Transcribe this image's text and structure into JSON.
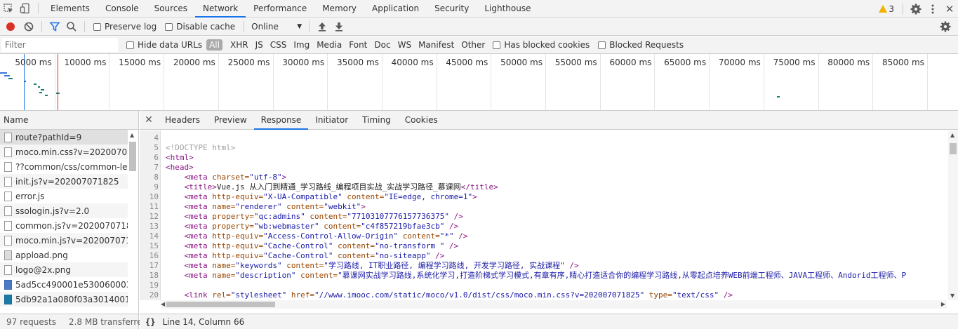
{
  "devtools": {
    "panels": [
      "Elements",
      "Console",
      "Sources",
      "Network",
      "Performance",
      "Memory",
      "Application",
      "Security",
      "Lighthouse"
    ],
    "active_panel": "Network",
    "warning_count": "3"
  },
  "toolbar": {
    "preserve_log": "Preserve log",
    "disable_cache": "Disable cache",
    "throttle": "Online"
  },
  "filterbar": {
    "placeholder": "Filter",
    "hide_data_urls": "Hide data URLs",
    "types": [
      "All",
      "XHR",
      "JS",
      "CSS",
      "Img",
      "Media",
      "Font",
      "Doc",
      "WS",
      "Manifest",
      "Other"
    ],
    "has_blocked_cookies": "Has blocked cookies",
    "blocked_requests": "Blocked Requests"
  },
  "overview": {
    "ticks": [
      "5000 ms",
      "10000 ms",
      "15000 ms",
      "20000 ms",
      "25000 ms",
      "30000 ms",
      "35000 ms",
      "40000 ms",
      "45000 ms",
      "50000 ms",
      "55000 ms",
      "60000 ms",
      "65000 ms",
      "70000 ms",
      "75000 ms",
      "80000 ms",
      "85000 ms",
      "90"
    ]
  },
  "requests": {
    "header": "Name",
    "items": [
      {
        "name": "route?pathId=9",
        "icon": "doc"
      },
      {
        "name": "moco.min.css?v=2020070718",
        "icon": "doc"
      },
      {
        "name": "??common/css/common-less.",
        "icon": "doc"
      },
      {
        "name": "init.js?v=202007071825",
        "icon": "doc"
      },
      {
        "name": "error.js",
        "icon": "doc"
      },
      {
        "name": "ssologin.js?v=2.0",
        "icon": "doc"
      },
      {
        "name": "common.js?v=202007071825",
        "icon": "doc"
      },
      {
        "name": "moco.min.js?v=202007071825",
        "icon": "doc"
      },
      {
        "name": "appload.png",
        "icon": "img"
      },
      {
        "name": "logo@2x.png",
        "icon": "doc"
      },
      {
        "name": "5ad5cc490001e53006000338.j",
        "icon": "blue"
      },
      {
        "name": "5db92a1a080f03a301400140.j",
        "icon": "teal"
      }
    ]
  },
  "details": {
    "tabs": [
      "Headers",
      "Preview",
      "Response",
      "Initiator",
      "Timing",
      "Cookies"
    ],
    "active_tab": "Response",
    "lines": [
      {
        "n": "4",
        "parts": []
      },
      {
        "n": "5",
        "parts": [
          {
            "c": "c-gray",
            "t": "<!DOCTYPE html>"
          }
        ]
      },
      {
        "n": "6",
        "parts": [
          {
            "c": "c-tag",
            "t": "<html>"
          }
        ]
      },
      {
        "n": "7",
        "parts": [
          {
            "c": "c-tag",
            "t": "<head>"
          }
        ]
      },
      {
        "n": "8",
        "parts": [
          {
            "c": "c-text",
            "t": "    "
          },
          {
            "c": "c-tag",
            "t": "<meta "
          },
          {
            "c": "c-attr",
            "t": "charset="
          },
          {
            "c": "c-val",
            "t": "\"utf-8\""
          },
          {
            "c": "c-tag",
            "t": ">"
          }
        ]
      },
      {
        "n": "9",
        "parts": [
          {
            "c": "c-text",
            "t": "    "
          },
          {
            "c": "c-tag",
            "t": "<title>"
          },
          {
            "c": "c-text",
            "t": "Vue.js 从入门到精通_学习路线_编程项目实战_实战学习路径_慕课网"
          },
          {
            "c": "c-tag",
            "t": "</title>"
          }
        ]
      },
      {
        "n": "10",
        "parts": [
          {
            "c": "c-text",
            "t": "    "
          },
          {
            "c": "c-tag",
            "t": "<meta "
          },
          {
            "c": "c-attr",
            "t": "http-equiv="
          },
          {
            "c": "c-val",
            "t": "\"X-UA-Compatible\""
          },
          {
            "c": "c-attr",
            "t": " content="
          },
          {
            "c": "c-val",
            "t": "\"IE=edge, chrome=1\""
          },
          {
            "c": "c-tag",
            "t": ">"
          }
        ]
      },
      {
        "n": "11",
        "parts": [
          {
            "c": "c-text",
            "t": "    "
          },
          {
            "c": "c-tag",
            "t": "<meta "
          },
          {
            "c": "c-attr",
            "t": "name="
          },
          {
            "c": "c-val",
            "t": "\"renderer\""
          },
          {
            "c": "c-attr",
            "t": " content="
          },
          {
            "c": "c-val",
            "t": "\"webkit\""
          },
          {
            "c": "c-tag",
            "t": ">"
          }
        ]
      },
      {
        "n": "12",
        "parts": [
          {
            "c": "c-text",
            "t": "    "
          },
          {
            "c": "c-tag",
            "t": "<meta "
          },
          {
            "c": "c-attr",
            "t": "property="
          },
          {
            "c": "c-val",
            "t": "\"qc:admins\""
          },
          {
            "c": "c-attr",
            "t": " content="
          },
          {
            "c": "c-val",
            "t": "\"77103107776157736375\""
          },
          {
            "c": "c-tag",
            "t": " />"
          }
        ]
      },
      {
        "n": "13",
        "parts": [
          {
            "c": "c-text",
            "t": "    "
          },
          {
            "c": "c-tag",
            "t": "<meta "
          },
          {
            "c": "c-attr",
            "t": "property="
          },
          {
            "c": "c-val",
            "t": "\"wb:webmaster\""
          },
          {
            "c": "c-attr",
            "t": " content="
          },
          {
            "c": "c-val",
            "t": "\"c4f857219bfae3cb\""
          },
          {
            "c": "c-tag",
            "t": " />"
          }
        ]
      },
      {
        "n": "14",
        "parts": [
          {
            "c": "c-text",
            "t": "    "
          },
          {
            "c": "c-tag",
            "t": "<meta "
          },
          {
            "c": "c-attr",
            "t": "http-equiv="
          },
          {
            "c": "c-val",
            "t": "\"Access-Control-Allow-Origin\""
          },
          {
            "c": "c-attr",
            "t": " content="
          },
          {
            "c": "c-val",
            "t": "\"*\""
          },
          {
            "c": "c-tag",
            "t": " />"
          }
        ]
      },
      {
        "n": "15",
        "parts": [
          {
            "c": "c-text",
            "t": "    "
          },
          {
            "c": "c-tag",
            "t": "<meta "
          },
          {
            "c": "c-attr",
            "t": "http-equiv="
          },
          {
            "c": "c-val",
            "t": "\"Cache-Control\""
          },
          {
            "c": "c-attr",
            "t": " content="
          },
          {
            "c": "c-val",
            "t": "\"no-transform \""
          },
          {
            "c": "c-tag",
            "t": " />"
          }
        ]
      },
      {
        "n": "16",
        "parts": [
          {
            "c": "c-text",
            "t": "    "
          },
          {
            "c": "c-tag",
            "t": "<meta "
          },
          {
            "c": "c-attr",
            "t": "http-equiv="
          },
          {
            "c": "c-val",
            "t": "\"Cache-Control\""
          },
          {
            "c": "c-attr",
            "t": " content="
          },
          {
            "c": "c-val",
            "t": "\"no-siteapp\""
          },
          {
            "c": "c-tag",
            "t": " />"
          }
        ]
      },
      {
        "n": "17",
        "parts": [
          {
            "c": "c-text",
            "t": "    "
          },
          {
            "c": "c-tag",
            "t": "<meta "
          },
          {
            "c": "c-attr",
            "t": "name="
          },
          {
            "c": "c-val",
            "t": "\"keywords\""
          },
          {
            "c": "c-attr",
            "t": " content="
          },
          {
            "c": "c-val",
            "t": "\"学习路线, IT职业路径, 编程学习路线, 开发学习路径, 实战课程\""
          },
          {
            "c": "c-tag",
            "t": " />"
          }
        ]
      },
      {
        "n": "18",
        "parts": [
          {
            "c": "c-text",
            "t": "    "
          },
          {
            "c": "c-tag",
            "t": "<meta "
          },
          {
            "c": "c-attr",
            "t": "name="
          },
          {
            "c": "c-val",
            "t": "\"description\""
          },
          {
            "c": "c-attr",
            "t": " content="
          },
          {
            "c": "c-val",
            "t": "\"慕课网实战学习路线,系统化学习,打造阶梯式学习模式,有章有序,精心打造适合你的编程学习路线,从零起点培养WEB前端工程师、JAVA工程师、Andorid工程师、P"
          }
        ]
      },
      {
        "n": "19",
        "parts": []
      },
      {
        "n": "20",
        "parts": [
          {
            "c": "c-text",
            "t": "    "
          },
          {
            "c": "c-tag",
            "t": "<link "
          },
          {
            "c": "c-attr",
            "t": "rel="
          },
          {
            "c": "c-val",
            "t": "\"stylesheet\""
          },
          {
            "c": "c-attr",
            "t": " href="
          },
          {
            "c": "c-val",
            "t": "\"//www.imooc.com/static/moco/v1.0/dist/css/moco.min.css?v=202007071825\""
          },
          {
            "c": "c-attr",
            "t": " type="
          },
          {
            "c": "c-val",
            "t": "\"text/css\""
          },
          {
            "c": "c-tag",
            "t": " />"
          }
        ]
      },
      {
        "n": "21",
        "parts": []
      }
    ]
  },
  "status": {
    "requests": "97 requests",
    "transferred": "2.8 MB transferred",
    "cursor": "Line 14, Column 66",
    "braces": "{}"
  }
}
